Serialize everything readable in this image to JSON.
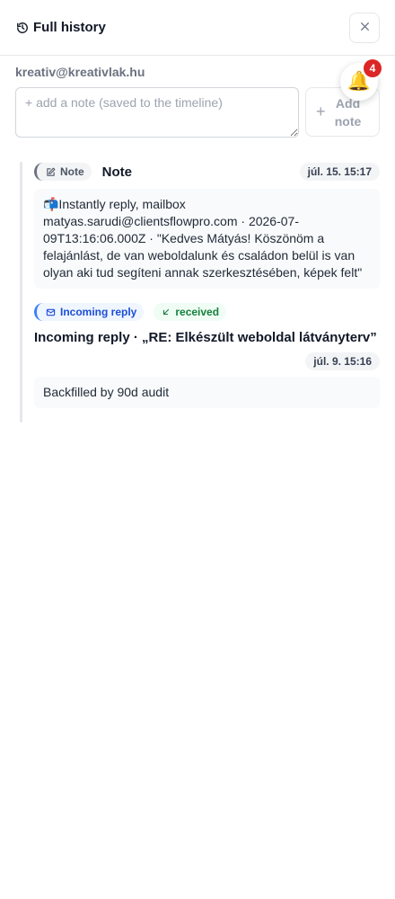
{
  "header": {
    "title": "Full history",
    "title_icon": "history-icon",
    "close_icon": "close-icon"
  },
  "contact": {
    "email": "kreativ@kreativlak.hu"
  },
  "note_form": {
    "placeholder": "+ add a note (saved to the timeline)",
    "value": "",
    "add_button_label": "Add note",
    "add_icon": "plus-icon"
  },
  "notifications": {
    "icon": "bell-icon",
    "count": "4"
  },
  "timeline": [
    {
      "type_label": "Note",
      "type_icon": "edit-icon",
      "title": "Note",
      "date": "júl. 15. 15:17",
      "body": "📬Instantly reply, mailbox matyas.sarudi@clientsflowpro.com · 2026-07-09T13:16:06.000Z · \"Kedves Mátyás!  Köszönöm a felajánlást, de van weboldalunk és családon belül is van olyan aki tud segíteni annak szerkesztésében, képek felt\""
    },
    {
      "type_label": "Incoming reply",
      "type_icon": "mail-icon",
      "status_label": "received",
      "status_icon": "arrow-down-left-icon",
      "title": "Incoming reply · „RE: Elkészült weboldal látványterv”",
      "date": "júl. 9. 15:16",
      "body": "Backfilled by 90d audit"
    }
  ],
  "colors": {
    "note_accent": "#6b7280",
    "incoming_accent": "#3b82f6",
    "received_green": "#15803d",
    "badge_red": "#dc2626"
  }
}
